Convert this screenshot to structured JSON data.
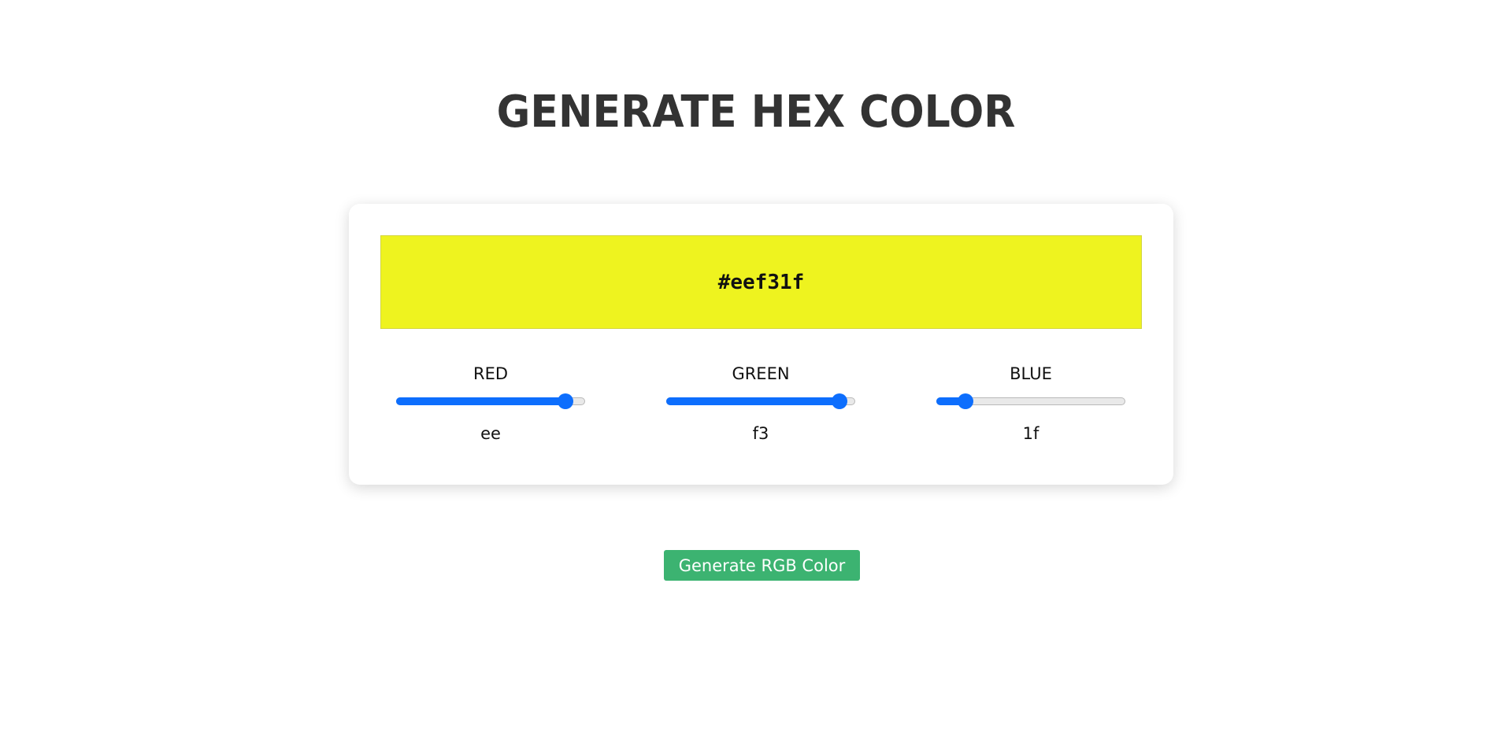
{
  "page": {
    "title": "GENERATE HEX COLOR"
  },
  "swatch": {
    "hex": "#eef31f",
    "color": "#eef31f"
  },
  "channels": [
    {
      "label": "RED",
      "value": "ee",
      "level": 238,
      "max": 255
    },
    {
      "label": "GREEN",
      "value": "f3",
      "level": 243,
      "max": 255
    },
    {
      "label": "BLUE",
      "value": "1f",
      "level": 31,
      "max": 255
    }
  ],
  "colors": {
    "slider_accent": "#0d6efd",
    "button_bg": "#3cb371",
    "title_color": "#333333"
  },
  "button": {
    "label": "Generate RGB Color"
  }
}
